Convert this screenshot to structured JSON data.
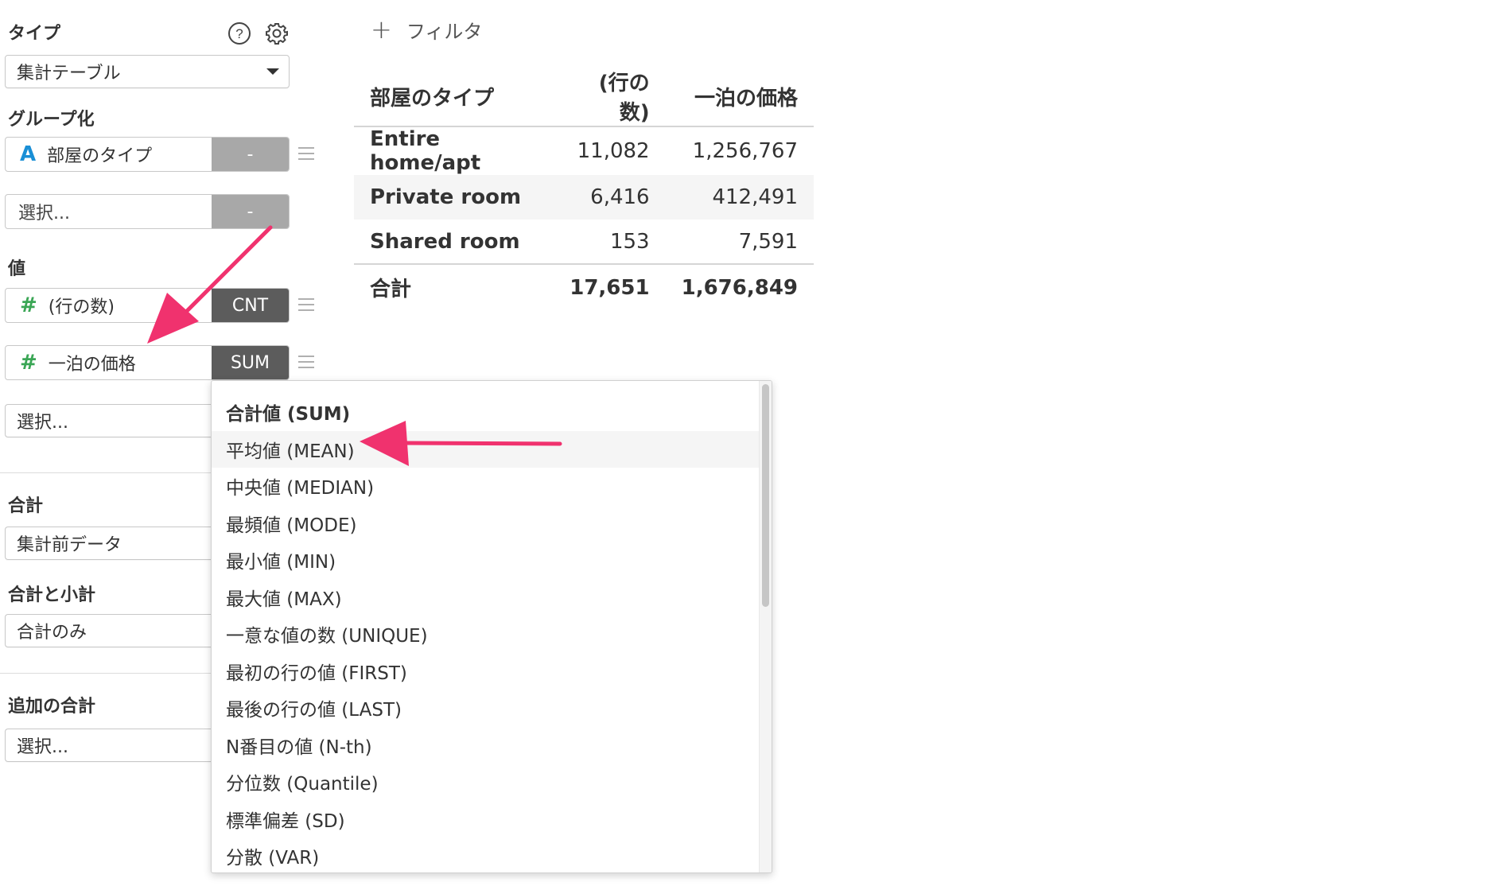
{
  "panel": {
    "type_label": "タイプ",
    "type_value": "集計テーブル",
    "group_label": "グループ化",
    "group_field": {
      "type_glyph": "A",
      "name": "部屋のタイプ",
      "agg": "-"
    },
    "group_select": {
      "placeholder": "選択...",
      "agg": "-"
    },
    "value_label": "値",
    "value_fields": [
      {
        "type_glyph": "#",
        "name": "(行の数)",
        "agg": "CNT"
      },
      {
        "type_glyph": "#",
        "name": "一泊の価格",
        "agg": "SUM"
      }
    ],
    "value_select": "選択...",
    "total_label": "合計",
    "total_value": "集計前データ",
    "subtotal_label": "合計と小計",
    "subtotal_value": "合計のみ",
    "extra_label": "追加の合計",
    "extra_value": "選択..."
  },
  "filter_label": "フィルタ",
  "filter_icon": "plus-icon",
  "table": {
    "headers": [
      "部屋のタイプ",
      "(行の数)",
      "一泊の価格"
    ],
    "rows": [
      [
        "Entire home/apt",
        "11,082",
        "1,256,767"
      ],
      [
        "Private room",
        "6,416",
        "412,491"
      ],
      [
        "Shared room",
        "153",
        "7,591"
      ]
    ],
    "total": [
      "合計",
      "17,651",
      "1,676,849"
    ]
  },
  "dropdown": {
    "options": [
      "合計値 (SUM)",
      "平均値 (MEAN)",
      "中央値 (MEDIAN)",
      "最頻値 (MODE)",
      "最小値 (MIN)",
      "最大値 (MAX)",
      "一意な値の数 (UNIQUE)",
      "最初の行の値 (FIRST)",
      "最後の行の値 (LAST)",
      "N番目の値 (N-th)",
      "分位数 (Quantile)",
      "標準偏差 (SD)",
      "分散 (VAR)"
    ],
    "highlighted": "平均値 (MEAN)"
  },
  "annotation_color": "#f0326e",
  "colors": {
    "text_type_icon": "#1a8fd6",
    "number_type_icon": "#3aa655",
    "agg_dark": "#5c5c5c",
    "agg_grey": "#a8a8a8"
  }
}
